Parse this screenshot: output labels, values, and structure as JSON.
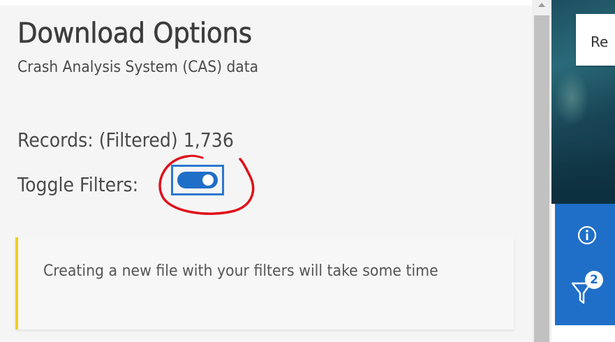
{
  "panel": {
    "title": "Download Options",
    "subtitle": "Crash Analysis System (CAS) data",
    "records_label": "Records: (Filtered) 1,736",
    "toggle_label": "Toggle Filters:",
    "toggle_state": "on",
    "notice_text": "Creating a new file with your filters will take some time"
  },
  "map": {
    "search_placeholder_partial": "Re"
  },
  "toolbar": {
    "info_icon": "info-icon",
    "filter_icon": "filter-icon",
    "filter_count": "2"
  },
  "colors": {
    "accent_blue": "#1f6fc8",
    "notice_border": "#f0d020",
    "annotation_red": "#e0101a"
  }
}
